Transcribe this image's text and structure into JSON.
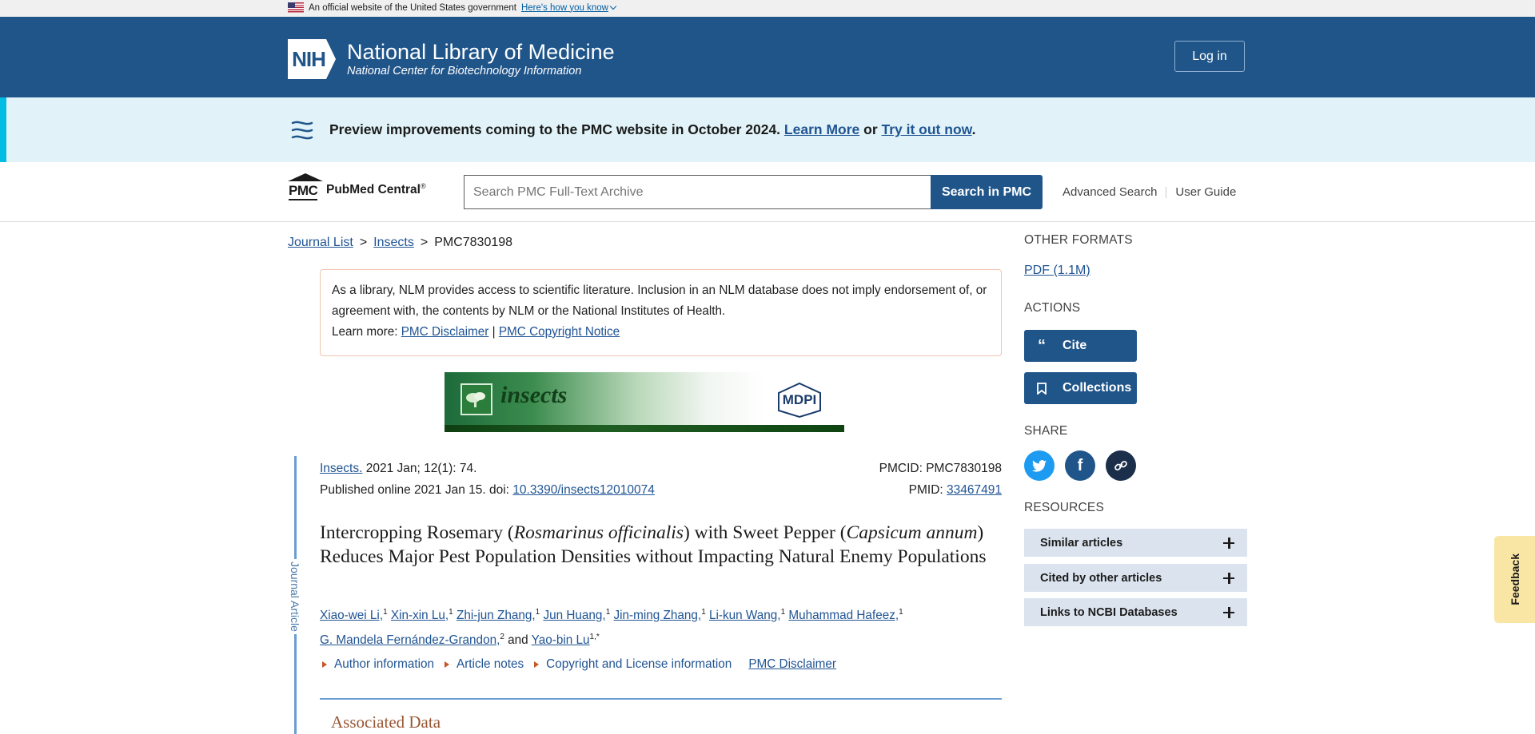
{
  "gov_banner": {
    "text": "An official website of the United States government",
    "link": "Here's how you know"
  },
  "header": {
    "logo_text": "NIH",
    "title": "National Library of Medicine",
    "subtitle": "National Center for Biotechnology Information",
    "login_label": "Log in"
  },
  "preview": {
    "text": "Preview improvements coming to the PMC website in October 2024.",
    "learn_more": "Learn More",
    "or": "or",
    "try_it": "Try it out now",
    "period": "."
  },
  "search": {
    "logo_pmc": "PMC",
    "logo_name": "PubMed Central",
    "logo_reg": "®",
    "placeholder": "Search PMC Full-Text Archive",
    "button": "Search in PMC",
    "advanced": "Advanced Search",
    "user_guide": "User Guide"
  },
  "breadcrumb": {
    "items": [
      "Journal List",
      "Insects",
      "PMC7830198"
    ],
    "separator": ">"
  },
  "disclaimer": {
    "text": "As a library, NLM provides access to scientific literature. Inclusion in an NLM database does not imply endorsement of, or agreement with, the contents by NLM or the National Institutes of Health.",
    "learn_more": "Learn more:",
    "link1": "PMC Disclaimer",
    "sep": "|",
    "link2": "PMC Copyright Notice"
  },
  "journal_banner": {
    "name": "insects",
    "publisher": "MDPI"
  },
  "article": {
    "label": "Journal Article",
    "journal": "Insects.",
    "citation": "2021 Jan; 12(1): 74.",
    "published": "Published online 2021 Jan 15. doi:",
    "doi": "10.3390/insects12010074",
    "pmcid_label": "PMCID:",
    "pmcid": "PMC7830198",
    "pmid_label": "PMID:",
    "pmid": "33467491",
    "title_part1": "Intercropping Rosemary (",
    "title_italic1": "Rosmarinus officinalis",
    "title_part2": ") with Sweet Pepper (",
    "title_italic2": "Capsicum annum",
    "title_part3": ") Reduces Major Pest Population Densities without Impacting Natural Enemy Populations",
    "authors": [
      {
        "name": "Xiao-wei Li,",
        "sup": "1"
      },
      {
        "name": "Xin-xin Lu,",
        "sup": "1"
      },
      {
        "name": "Zhi-jun Zhang,",
        "sup": "1"
      },
      {
        "name": "Jun Huang,",
        "sup": "1"
      },
      {
        "name": "Jin-ming Zhang,",
        "sup": "1"
      },
      {
        "name": "Li-kun Wang,",
        "sup": "1"
      },
      {
        "name": "Muhammad Hafeez,",
        "sup": "1"
      },
      {
        "name": "G. Mandela Fernández-Grandon,",
        "sup": "2"
      },
      {
        "name": "Yao-bin Lu",
        "sup": "1,*"
      }
    ],
    "and": "and",
    "sections": [
      "Author information",
      "Article notes",
      "Copyright and License information"
    ],
    "pmc_disclaimer": "PMC Disclaimer",
    "associated_data": "Associated Data"
  },
  "sidebar": {
    "other_formats": "OTHER FORMATS",
    "pdf": "PDF (1.1M)",
    "actions": "ACTIONS",
    "cite": "Cite",
    "collections": "Collections",
    "share": "SHARE",
    "resources": "RESOURCES",
    "resource_items": [
      "Similar articles",
      "Cited by other articles",
      "Links to NCBI Databases"
    ]
  },
  "feedback": "Feedback",
  "colors": {
    "header_blue": "#20558a",
    "preview_bg": "#e1f3f8",
    "twitter": "#1d9bf0",
    "facebook": "#20558a",
    "link_share": "#1b2f4a",
    "feedback_bg": "#f9e5a4"
  }
}
